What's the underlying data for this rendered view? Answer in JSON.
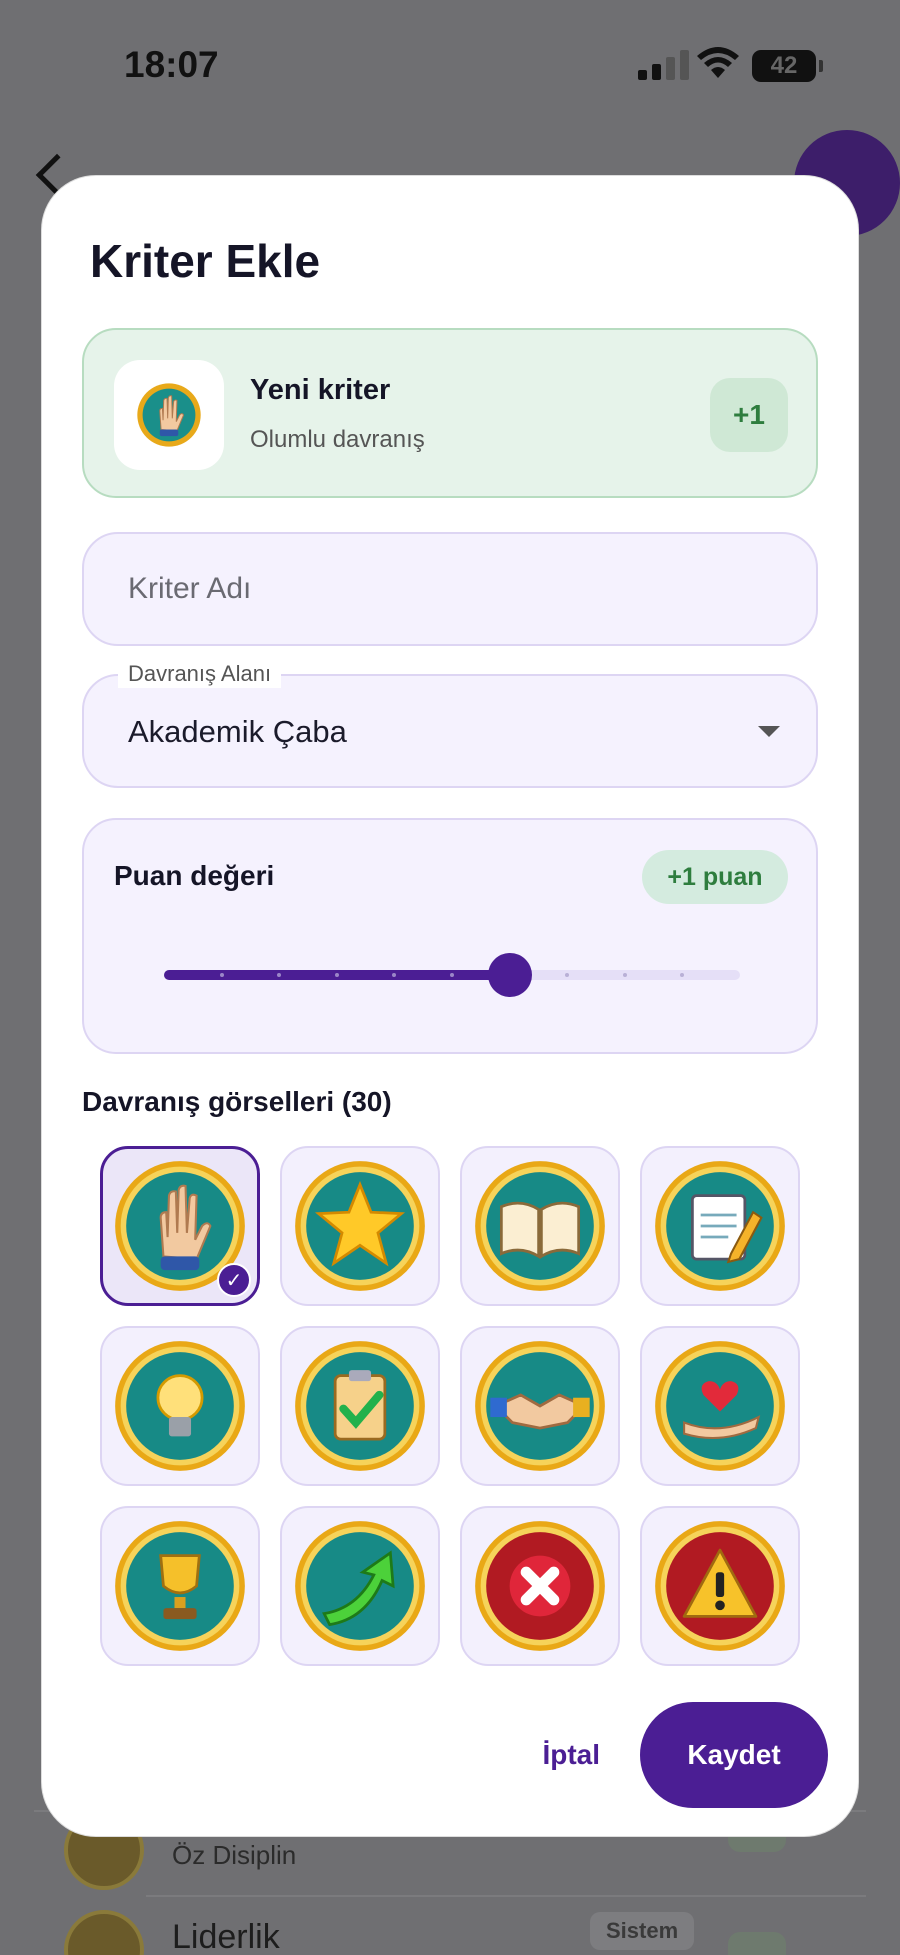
{
  "status_bar": {
    "time": "18:07",
    "battery": "42"
  },
  "modal": {
    "title": "Kriter Ekle",
    "preview": {
      "name": "Yeni kriter",
      "subtitle": "Olumlu davranış",
      "points": "+1"
    },
    "name_input": {
      "placeholder": "Kriter Adı",
      "value": ""
    },
    "behavior_area": {
      "label": "Davranış Alanı",
      "value": "Akademik Çaba"
    },
    "points": {
      "title": "Puan değeri",
      "badge": "+1 puan",
      "level_fraction": 0.6
    },
    "gallery": {
      "title": "Davranış görselleri (30)",
      "items": [
        {
          "icon": "raised-hand-icon",
          "selected": true
        },
        {
          "icon": "star-icon",
          "selected": false
        },
        {
          "icon": "open-book-icon",
          "selected": false
        },
        {
          "icon": "notepad-pencil-icon",
          "selected": false
        },
        {
          "icon": "lightbulb-icon",
          "selected": false
        },
        {
          "icon": "clipboard-check-icon",
          "selected": false
        },
        {
          "icon": "handshake-icon",
          "selected": false
        },
        {
          "icon": "heart-in-hand-icon",
          "selected": false
        },
        {
          "icon": "trophy-icon",
          "selected": false
        },
        {
          "icon": "arrow-up-icon",
          "selected": false
        },
        {
          "icon": "x-mark-icon",
          "selected": false
        },
        {
          "icon": "warning-icon",
          "selected": false
        }
      ]
    },
    "actions": {
      "cancel": "İptal",
      "save": "Kaydet"
    }
  },
  "background": {
    "item1": "Öz Disiplin",
    "item2": "Liderlik",
    "item2_badge": "Sistem"
  },
  "colors": {
    "primary": "#4b1e94",
    "positive": "#2e7d3e",
    "positive_bg": "#e6f3ea",
    "field_bg": "#f5f2fe"
  }
}
